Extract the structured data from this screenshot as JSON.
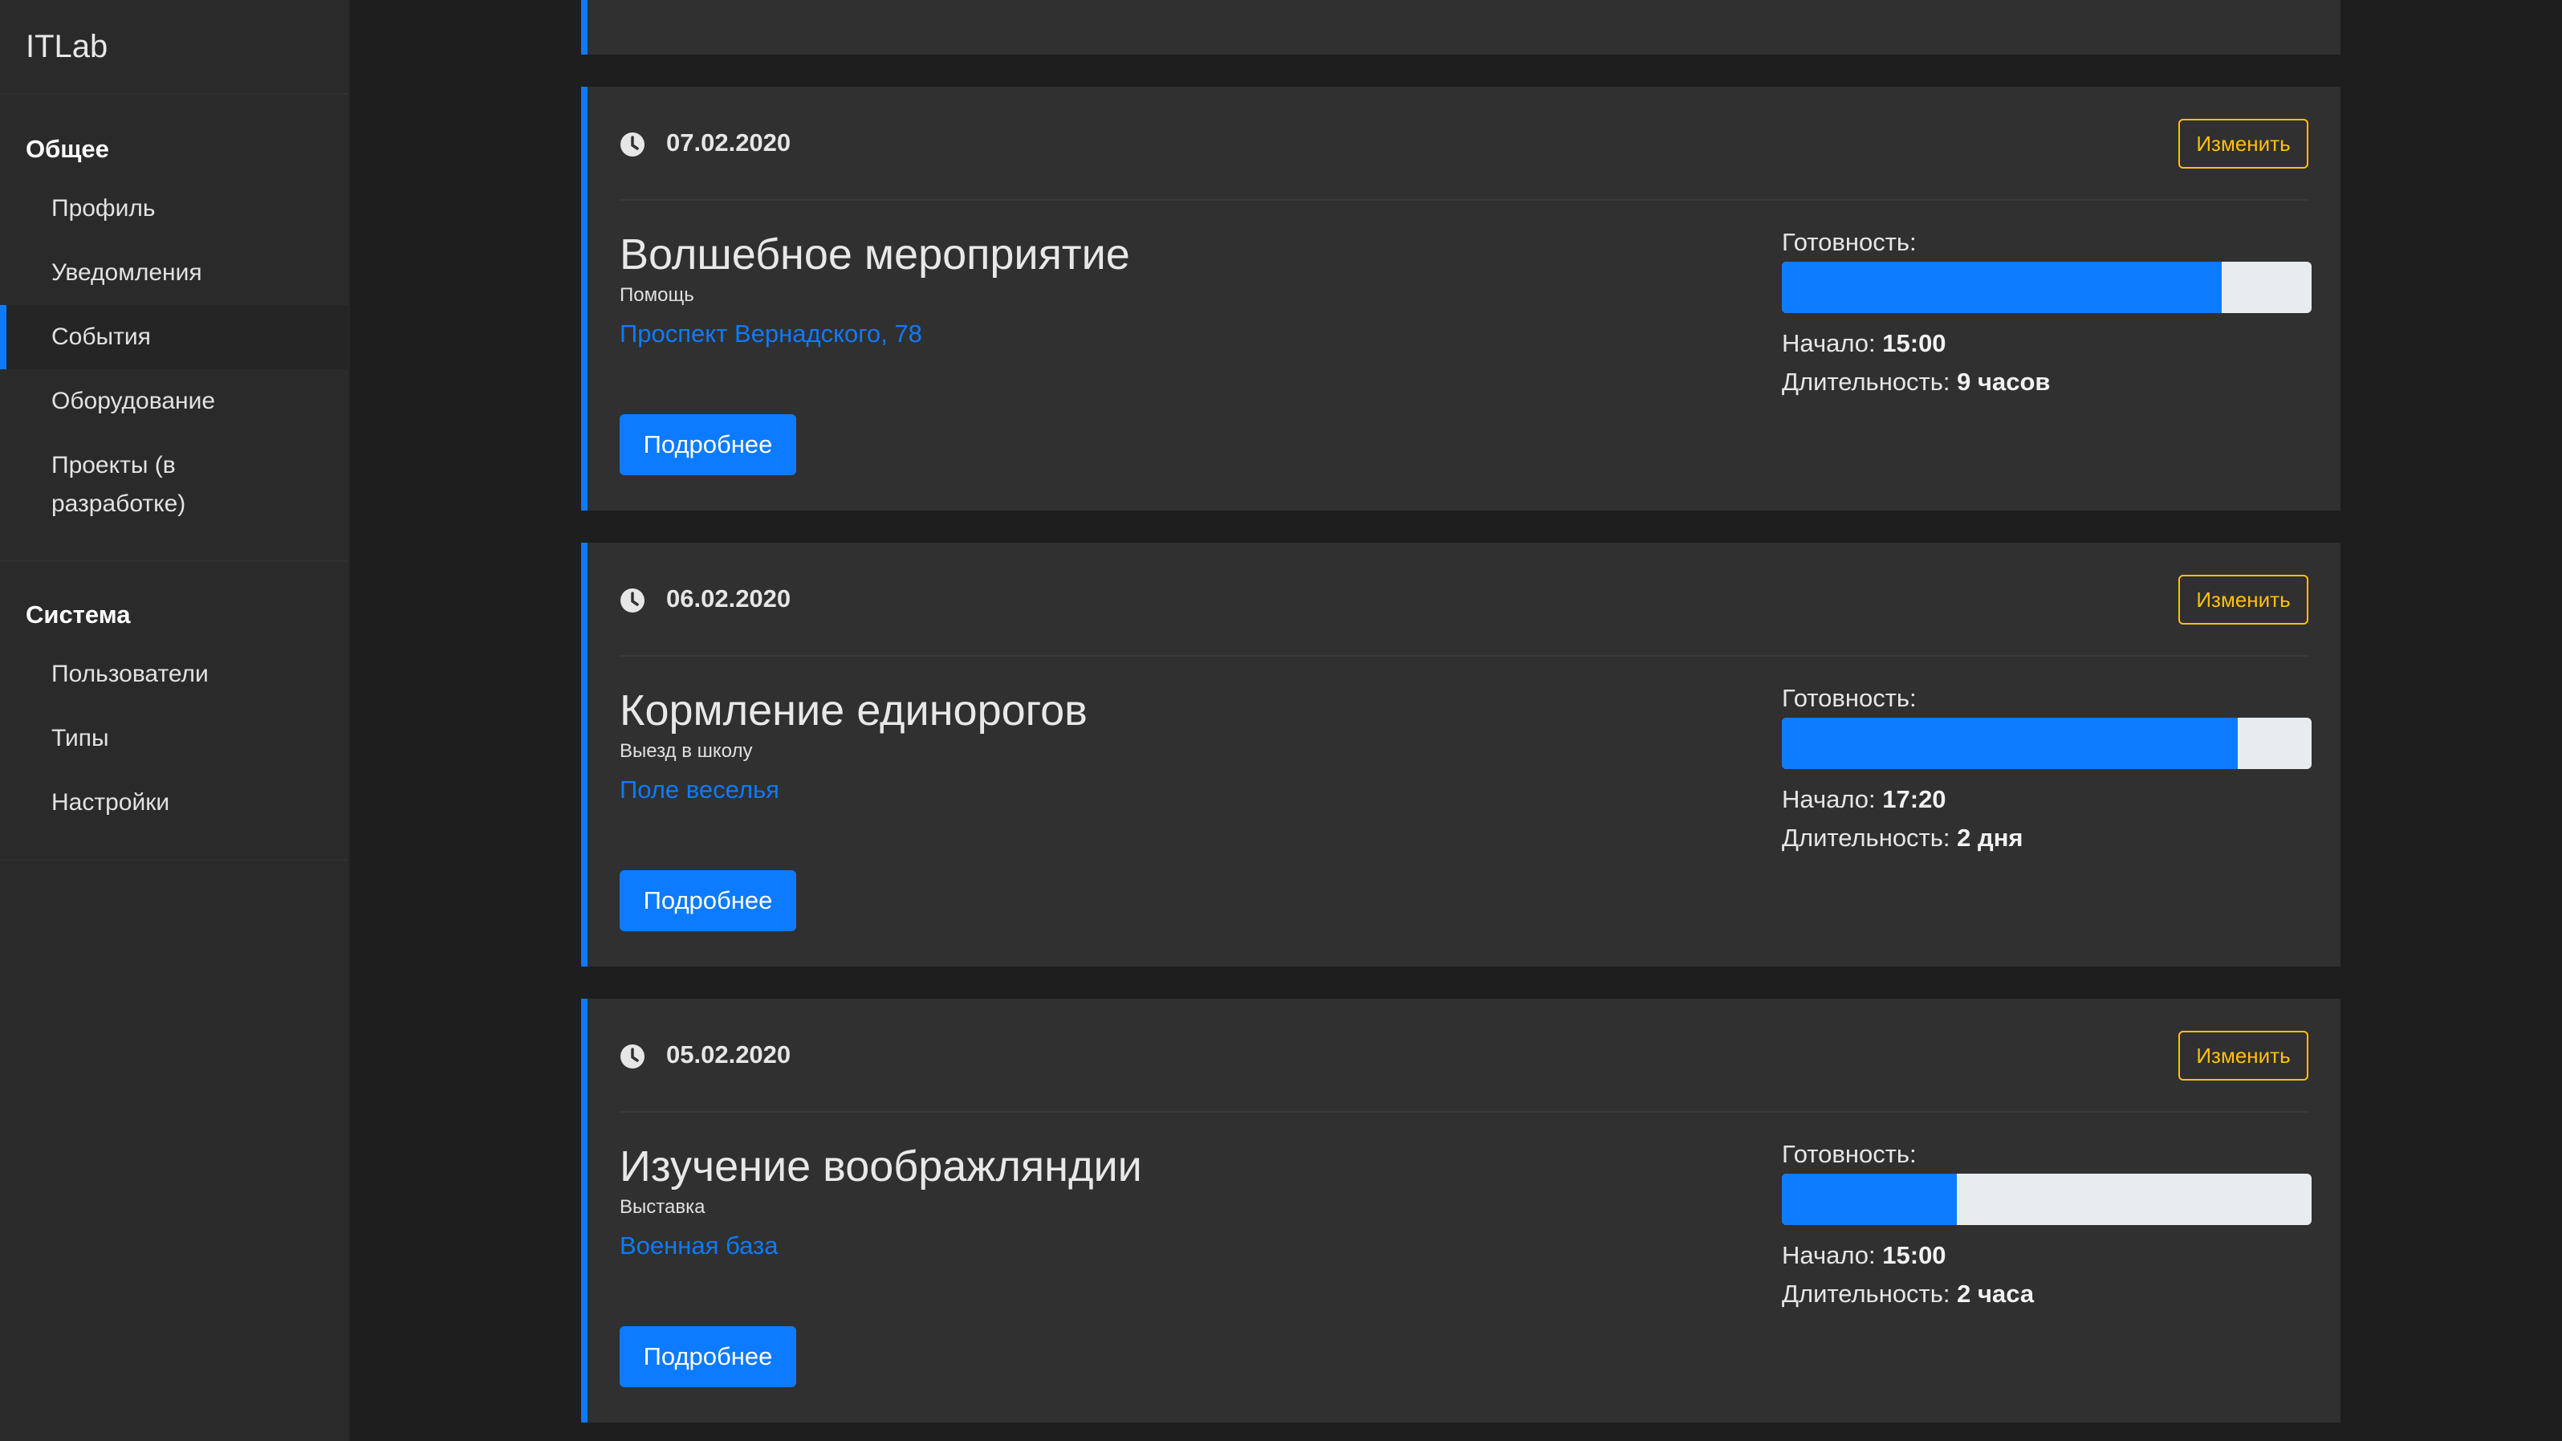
{
  "app": {
    "brand": "ITLab"
  },
  "sidebar": {
    "sections": [
      {
        "title": "Общее",
        "items": [
          {
            "label": "Профиль"
          },
          {
            "label": "Уведомления"
          },
          {
            "label": "События",
            "active": true
          },
          {
            "label": "Оборудование"
          },
          {
            "label": "Проекты (в разработке)"
          }
        ]
      },
      {
        "title": "Система",
        "items": [
          {
            "label": "Пользователи"
          },
          {
            "label": "Типы"
          },
          {
            "label": "Настройки"
          }
        ]
      }
    ]
  },
  "labels": {
    "edit": "Изменить",
    "more": "Подробнее",
    "readiness": "Готовность:",
    "start": "Начало:",
    "duration": "Длительность:"
  },
  "events": [
    {
      "date": "07.02.2020",
      "title": "Волшебное мероприятие",
      "type": "Помощь",
      "place": "Проспект Вернадского, 78",
      "readiness": 0.83,
      "start": "15:00",
      "duration": "9 часов"
    },
    {
      "date": "06.02.2020",
      "title": "Кормление единорогов",
      "type": "Выезд в школу",
      "place": "Поле веселья",
      "readiness": 0.86,
      "start": "17:20",
      "duration": "2 дня"
    },
    {
      "date": "05.02.2020",
      "title": "Изучение воображляндии",
      "type": "Выставка",
      "place": "Военная база",
      "readiness": 0.33,
      "start": "15:00",
      "duration": "2 часа"
    }
  ],
  "colors": {
    "accent": "#0d7bff",
    "warning": "#ffc107",
    "card_bg": "#303030",
    "page_bg": "#1e1e1e",
    "sidebar_bg": "#2a2a2a"
  }
}
